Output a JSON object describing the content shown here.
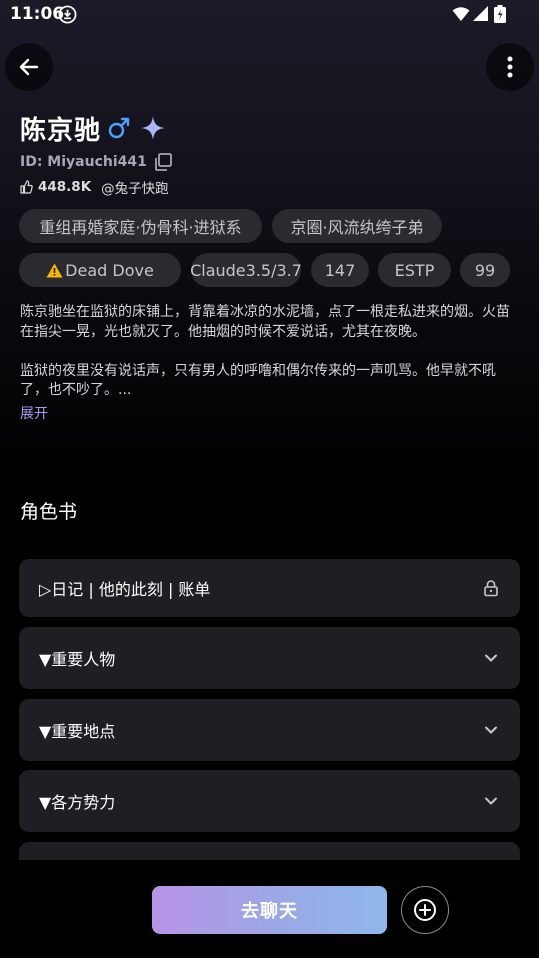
{
  "status_bar": {
    "time": "11:06"
  },
  "profile": {
    "name": "陈京驰",
    "id_text": "ID: Miyauchi441",
    "likes": "448.8K",
    "author": "@兔子快跑"
  },
  "tags": [
    "重组再婚家庭·伪骨科·进狱系",
    "京圈·风流纨绔子弟",
    "Dead Dove",
    "Claude3.5/3.7",
    "147",
    "ESTP",
    "99"
  ],
  "description": {
    "para1": "陈京驰坐在监狱的床铺上，背靠着冰凉的水泥墙，点了一根走私进来的烟。火苗在指尖一晃，光也就灭了。他抽烟的时候不爱说话，尤其在夜晚。",
    "para2": "监狱的夜里没有说话声，只有男人的呼噜和偶尔传来的一声叽骂。他早就不吼了，也不吵了。...",
    "expand_label": "展开"
  },
  "character_book": {
    "title": "角色书",
    "entries": [
      {
        "label": "▷日记 | 他的此刻 | 账单",
        "icon": "lock-icon"
      },
      {
        "label": "▼重要人物",
        "icon": "chevron-down-icon"
      },
      {
        "label": "▼重要地点",
        "icon": "chevron-down-icon"
      },
      {
        "label": "▼各方势力",
        "icon": "chevron-down-icon"
      }
    ]
  },
  "actions": {
    "chat_label": "去聊天"
  },
  "colors": {
    "accent_gradient_start": "#b894e6",
    "accent_gradient_end": "#8fb7ea",
    "male_symbol": "#4aa3ff",
    "expand_link": "#a99af0"
  }
}
